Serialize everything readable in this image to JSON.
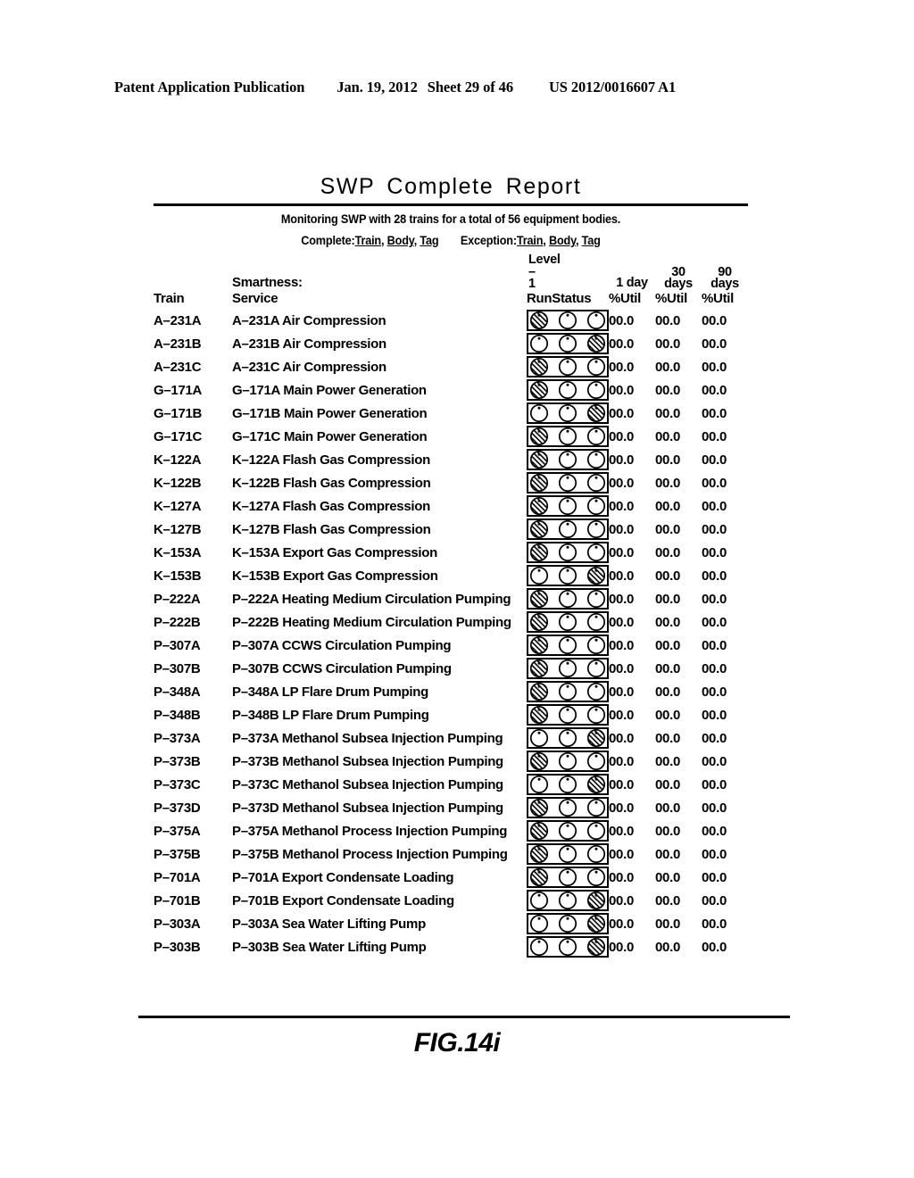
{
  "patent_header": {
    "publication": "Patent Application Publication",
    "date": "Jan. 19, 2012",
    "sheet": "Sheet 29 of 46",
    "number": "US 2012/0016607 A1"
  },
  "report": {
    "title": "SWP Complete Report",
    "subtitle": "Monitoring SWP with 28 trains for a total of 56 equipment bodies.",
    "links": {
      "complete_label": "Complete:",
      "exception_label": "Exception:",
      "items": [
        "Train",
        "Body",
        "Tag"
      ],
      "complete_train": "Train",
      "complete_body": "Body",
      "complete_tag": "Tag",
      "exception_train": "Train",
      "exception_body": "Body",
      "exception_tag": "Tag"
    },
    "headers": {
      "smartness": "Smartness:",
      "level_word": "Level",
      "level_dash": "–",
      "level_number": "1",
      "period_1day": "1 day",
      "period_30_top": "30",
      "period_30_bottom": "days",
      "period_90_top": "90",
      "period_90_bottom": "days",
      "train": "Train",
      "service": "Service",
      "runstatus": "RunStatus",
      "util1": "%Util",
      "util2": "%Util",
      "util3": "%Util"
    },
    "rows": [
      {
        "train": "A–231A",
        "body": "A–231A",
        "service": "Air Compression",
        "status": [
          "hatched",
          "plain",
          "plain"
        ],
        "util_1day": "00.0",
        "util_30day": "00.0",
        "util_90day": "00.0"
      },
      {
        "train": "A–231B",
        "body": "A–231B",
        "service": "Air Compression",
        "status": [
          "plain",
          "plain",
          "hatched"
        ],
        "util_1day": "00.0",
        "util_30day": "00.0",
        "util_90day": "00.0"
      },
      {
        "train": "A–231C",
        "body": "A–231C",
        "service": "Air Compression",
        "status": [
          "hatched",
          "plain",
          "plain"
        ],
        "util_1day": "00.0",
        "util_30day": "00.0",
        "util_90day": "00.0"
      },
      {
        "train": "G–171A",
        "body": "G–171A",
        "service": "Main Power Generation",
        "status": [
          "hatched",
          "plain",
          "plain"
        ],
        "util_1day": "00.0",
        "util_30day": "00.0",
        "util_90day": "00.0"
      },
      {
        "train": "G–171B",
        "body": "G–171B",
        "service": "Main Power Generation",
        "status": [
          "plain",
          "plain",
          "hatched"
        ],
        "util_1day": "00.0",
        "util_30day": "00.0",
        "util_90day": "00.0"
      },
      {
        "train": "G–171C",
        "body": "G–171C",
        "service": "Main Power Generation",
        "status": [
          "hatched",
          "plain",
          "plain"
        ],
        "util_1day": "00.0",
        "util_30day": "00.0",
        "util_90day": "00.0"
      },
      {
        "train": "K–122A",
        "body": "K–122A",
        "service": "Flash Gas Compression",
        "status": [
          "hatched",
          "plain",
          "plain"
        ],
        "util_1day": "00.0",
        "util_30day": "00.0",
        "util_90day": "00.0"
      },
      {
        "train": "K–122B",
        "body": "K–122B",
        "service": "Flash Gas Compression",
        "status": [
          "hatched",
          "plain",
          "plain"
        ],
        "util_1day": "00.0",
        "util_30day": "00.0",
        "util_90day": "00.0"
      },
      {
        "train": "K–127A",
        "body": "K–127A",
        "service": "Flash Gas Compression",
        "status": [
          "hatched",
          "plain",
          "plain"
        ],
        "util_1day": "00.0",
        "util_30day": "00.0",
        "util_90day": "00.0"
      },
      {
        "train": "K–127B",
        "body": "K–127B",
        "service": "Flash Gas Compression",
        "status": [
          "hatched",
          "plain",
          "plain"
        ],
        "util_1day": "00.0",
        "util_30day": "00.0",
        "util_90day": "00.0"
      },
      {
        "train": "K–153A",
        "body": "K–153A",
        "service": "Export Gas Compression",
        "status": [
          "hatched",
          "plain",
          "plain"
        ],
        "util_1day": "00.0",
        "util_30day": "00.0",
        "util_90day": "00.0"
      },
      {
        "train": "K–153B",
        "body": "K–153B",
        "service": "Export Gas Compression",
        "status": [
          "plain",
          "plain",
          "hatched"
        ],
        "util_1day": "00.0",
        "util_30day": "00.0",
        "util_90day": "00.0"
      },
      {
        "train": "P–222A",
        "body": "P–222A",
        "service": "Heating Medium Circulation Pumping",
        "status": [
          "hatched",
          "plain",
          "plain"
        ],
        "util_1day": "00.0",
        "util_30day": "00.0",
        "util_90day": "00.0"
      },
      {
        "train": "P–222B",
        "body": "P–222B",
        "service": "Heating Medium Circulation Pumping",
        "status": [
          "hatched",
          "plain",
          "plain"
        ],
        "util_1day": "00.0",
        "util_30day": "00.0",
        "util_90day": "00.0"
      },
      {
        "train": "P–307A",
        "body": "P–307A",
        "service": "CCWS Circulation Pumping",
        "status": [
          "hatched",
          "plain",
          "plain"
        ],
        "util_1day": "00.0",
        "util_30day": "00.0",
        "util_90day": "00.0"
      },
      {
        "train": "P–307B",
        "body": "P–307B",
        "service": "CCWS Circulation Pumping",
        "status": [
          "hatched",
          "plain",
          "plain"
        ],
        "util_1day": "00.0",
        "util_30day": "00.0",
        "util_90day": "00.0"
      },
      {
        "train": "P–348A",
        "body": "P–348A",
        "service": "LP Flare Drum Pumping",
        "status": [
          "hatched",
          "plain",
          "plain"
        ],
        "util_1day": "00.0",
        "util_30day": "00.0",
        "util_90day": "00.0"
      },
      {
        "train": "P–348B",
        "body": "P–348B",
        "service": "LP Flare Drum Pumping",
        "status": [
          "hatched",
          "plain",
          "plain"
        ],
        "util_1day": "00.0",
        "util_30day": "00.0",
        "util_90day": "00.0"
      },
      {
        "train": "P–373A",
        "body": "P–373A",
        "service": "Methanol Subsea Injection Pumping",
        "status": [
          "plain",
          "plain",
          "hatched"
        ],
        "util_1day": "00.0",
        "util_30day": "00.0",
        "util_90day": "00.0"
      },
      {
        "train": "P–373B",
        "body": "P–373B",
        "service": "Methanol Subsea Injection Pumping",
        "status": [
          "hatched",
          "plain",
          "plain"
        ],
        "util_1day": "00.0",
        "util_30day": "00.0",
        "util_90day": "00.0"
      },
      {
        "train": "P–373C",
        "body": "P–373C",
        "service": "Methanol Subsea Injection Pumping",
        "status": [
          "plain",
          "plain",
          "hatched"
        ],
        "util_1day": "00.0",
        "util_30day": "00.0",
        "util_90day": "00.0"
      },
      {
        "train": "P–373D",
        "body": "P–373D",
        "service": "Methanol Subsea Injection Pumping",
        "status": [
          "hatched",
          "plain",
          "plain"
        ],
        "util_1day": "00.0",
        "util_30day": "00.0",
        "util_90day": "00.0"
      },
      {
        "train": "P–375A",
        "body": "P–375A",
        "service": "Methanol Process Injection Pumping",
        "status": [
          "hatched",
          "plain",
          "plain"
        ],
        "util_1day": "00.0",
        "util_30day": "00.0",
        "util_90day": "00.0"
      },
      {
        "train": "P–375B",
        "body": "P–375B",
        "service": "Methanol Process Injection Pumping",
        "status": [
          "hatched",
          "plain",
          "plain"
        ],
        "util_1day": "00.0",
        "util_30day": "00.0",
        "util_90day": "00.0"
      },
      {
        "train": "P–701A",
        "body": "P–701A",
        "service": "Export Condensate Loading",
        "status": [
          "hatched",
          "plain",
          "plain"
        ],
        "util_1day": "00.0",
        "util_30day": "00.0",
        "util_90day": "00.0"
      },
      {
        "train": "P–701B",
        "body": "P–701B",
        "service": "Export Condensate Loading",
        "status": [
          "plain",
          "plain",
          "hatched"
        ],
        "util_1day": "00.0",
        "util_30day": "00.0",
        "util_90day": "00.0"
      },
      {
        "train": "P–303A",
        "body": "P–303A",
        "service": "Sea Water Lifting Pump",
        "status": [
          "plain",
          "plain",
          "hatched"
        ],
        "util_1day": "00.0",
        "util_30day": "00.0",
        "util_90day": "00.0"
      },
      {
        "train": "P–303B",
        "body": "P–303B",
        "service": "Sea Water Lifting Pump",
        "status": [
          "plain",
          "plain",
          "hatched"
        ],
        "util_1day": "00.0",
        "util_30day": "00.0",
        "util_90day": "00.0"
      }
    ]
  },
  "figure_caption": "FIG.14i"
}
